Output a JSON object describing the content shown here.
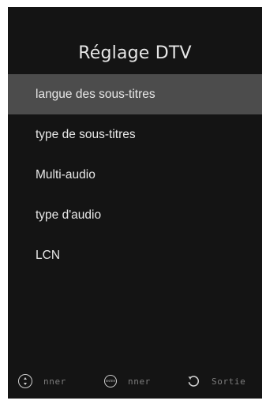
{
  "screen": {
    "title": "Réglage DTV"
  },
  "menu": {
    "items": [
      {
        "label": "langue des sous-titres",
        "selected": true
      },
      {
        "label": "type de sous-titres",
        "selected": false
      },
      {
        "label": "Multi-audio",
        "selected": false
      },
      {
        "label": "type d'audio",
        "selected": false
      },
      {
        "label": "LCN",
        "selected": false
      }
    ]
  },
  "footer": {
    "hints": [
      {
        "icon": "up-down-nav-icon",
        "label": "nner"
      },
      {
        "icon": "enter-button-icon",
        "icon_text": "ENTER",
        "label": "nner"
      },
      {
        "icon": "back-return-icon",
        "label": "Sortie"
      }
    ]
  },
  "colors": {
    "panel_background": "#141414",
    "selected_row": "#4c4c4c",
    "text": "#e8e8e8",
    "hint_text": "#7d7d7d"
  }
}
